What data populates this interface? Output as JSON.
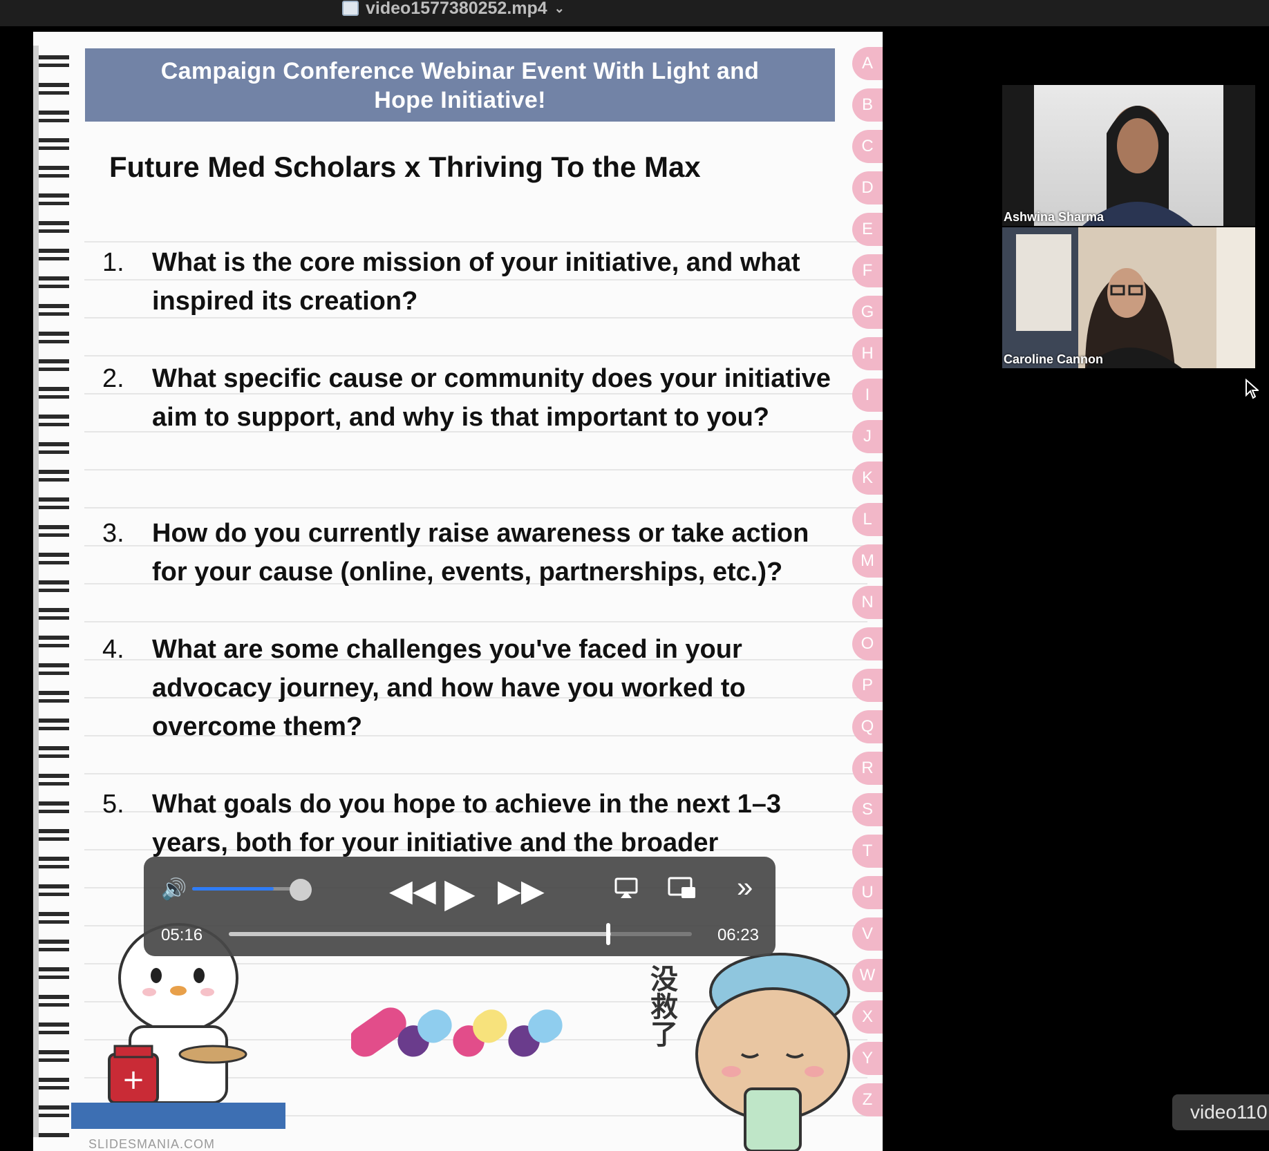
{
  "window": {
    "file_title": "video1577380252.mp4"
  },
  "slide": {
    "banner_line1": "Campaign Conference Webinar Event With  Light and",
    "banner_line2": "Hope Initiative!",
    "subtitle": "Future Med Scholars  x Thriving To the Max",
    "questions": [
      {
        "num": "1.",
        "text": "What is the core mission of your initiative, and what inspired its creation?"
      },
      {
        "num": "2.",
        "text": "What specific cause or community does your initiative aim to support, and why is that important to you?"
      },
      {
        "num": "3.",
        "text": "How do you currently raise awareness or take action for your cause (online, events, partnerships, etc.)?"
      },
      {
        "num": "4.",
        "text": "What are some challenges you've faced in your advocacy journey, and how have you worked to overcome them?"
      },
      {
        "num": "5.",
        "text": "What goals do you hope to achieve in the next 1–3 years, both for your initiative and the broader"
      }
    ],
    "tabs": [
      "A",
      "B",
      "C",
      "D",
      "E",
      "F",
      "G",
      "H",
      "I",
      "J",
      "K",
      "L",
      "M",
      "N",
      "O",
      "P",
      "Q",
      "R",
      "S",
      "T",
      "U",
      "V",
      "W",
      "X",
      "Y",
      "Z"
    ],
    "sticker_text": "没救了",
    "footer": "SLIDESMANIA.COM"
  },
  "participants": [
    {
      "name": "Ashwina Sharma"
    },
    {
      "name": "Caroline Cannon"
    }
  ],
  "player": {
    "current_time": "05:16",
    "total_time": "06:23",
    "progress": 0.825,
    "volume": 0.74
  },
  "bottom_right_label": "video110",
  "colors": {
    "banner": "#7283a6",
    "tab": "#f2b7c8",
    "volume_fill": "#2f7cf6"
  }
}
